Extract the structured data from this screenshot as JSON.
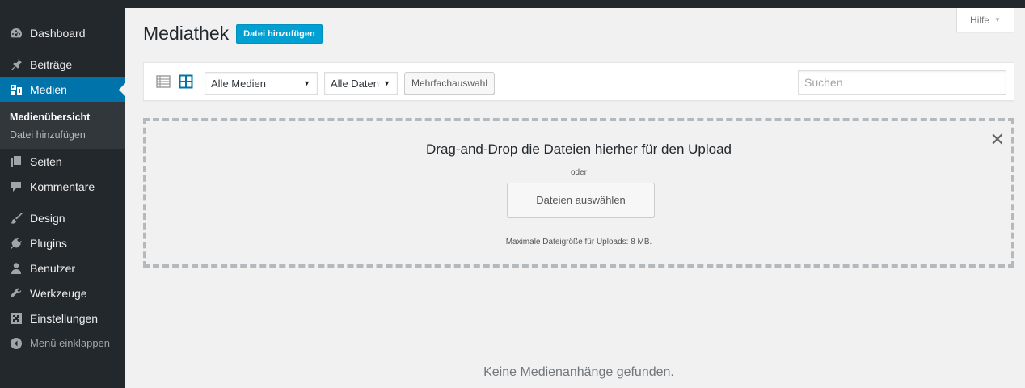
{
  "sidebar": {
    "items": [
      {
        "label": "Dashboard",
        "icon": "dashboard-icon"
      },
      {
        "label": "Beiträge",
        "icon": "pin-icon"
      },
      {
        "label": "Medien",
        "icon": "media-icon"
      },
      {
        "label": "Seiten",
        "icon": "pages-icon"
      },
      {
        "label": "Kommentare",
        "icon": "comments-icon"
      },
      {
        "label": "Design",
        "icon": "brush-icon"
      },
      {
        "label": "Plugins",
        "icon": "plugin-icon"
      },
      {
        "label": "Benutzer",
        "icon": "users-icon"
      },
      {
        "label": "Werkzeuge",
        "icon": "wrench-icon"
      },
      {
        "label": "Einstellungen",
        "icon": "settings-icon"
      }
    ],
    "submenu": [
      "Medienübersicht",
      "Datei hinzufügen"
    ],
    "collapse_label": "Menü einklappen"
  },
  "header": {
    "title": "Mediathek",
    "add_button": "Datei hinzufügen",
    "help_label": "Hilfe"
  },
  "toolbar": {
    "media_filter": "Alle Medien",
    "date_filter": "Alle Daten",
    "multi_select": "Mehrfachauswahl",
    "search_placeholder": "Suchen"
  },
  "dropzone": {
    "title": "Drag-and-Drop die Dateien hierher für den Upload",
    "or": "oder",
    "select_button": "Dateien auswählen",
    "max_size": "Maximale Dateigröße für Uploads: 8 MB."
  },
  "empty_message": "Keine Medienanhänge gefunden.",
  "colors": {
    "sidebar_bg": "#23282d",
    "active": "#0073aa",
    "accent_button": "#00a0d2",
    "grid_icon": "#0073aa"
  }
}
